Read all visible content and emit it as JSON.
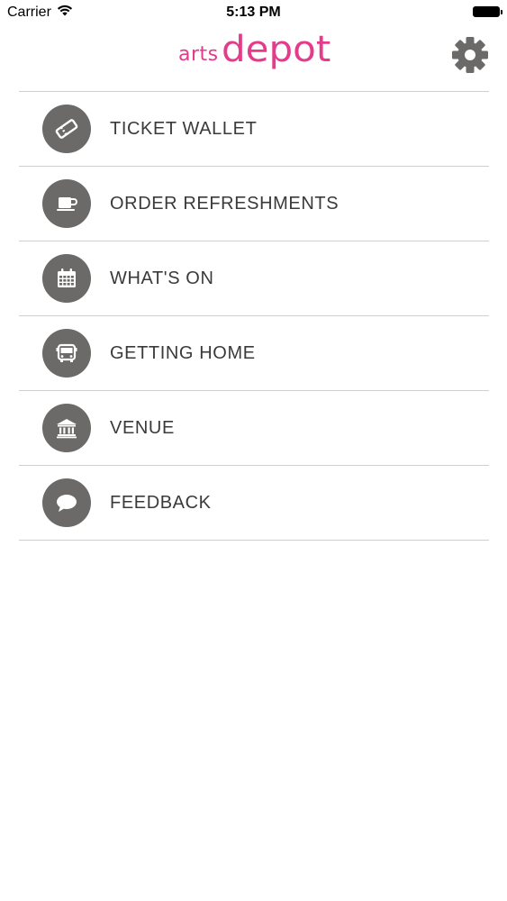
{
  "status_bar": {
    "carrier": "Carrier",
    "time": "5:13 PM"
  },
  "header": {
    "logo_arts": "arts",
    "logo_depot": "depot",
    "brand_color": "#e43b8c",
    "settings_icon": "gear-icon"
  },
  "menu": {
    "items": [
      {
        "label": "TICKET WALLET",
        "icon": "ticket-icon"
      },
      {
        "label": "ORDER REFRESHMENTS",
        "icon": "cup-icon"
      },
      {
        "label": "WHAT'S ON",
        "icon": "calendar-icon"
      },
      {
        "label": "GETTING HOME",
        "icon": "bus-icon"
      },
      {
        "label": "VENUE",
        "icon": "building-icon"
      },
      {
        "label": "FEEDBACK",
        "icon": "speech-bubble-icon"
      }
    ]
  }
}
